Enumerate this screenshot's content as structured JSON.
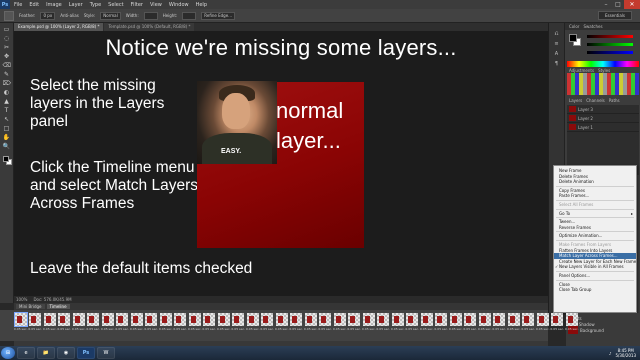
{
  "menubar": {
    "logo": "Ps",
    "items": [
      "File",
      "Edit",
      "Image",
      "Layer",
      "Type",
      "Select",
      "Filter",
      "View",
      "Window",
      "Help"
    ],
    "win_buttons": [
      "–",
      "□",
      "✕"
    ]
  },
  "options": {
    "feather_label": "Feather:",
    "feather_value": "0 px",
    "antialias_label": "Anti-alias",
    "style_label": "Style:",
    "style_value": "Normal",
    "width_label": "Width:",
    "height_label": "Height:",
    "refine_label": "Refine Edge...",
    "workspace": "Essentials"
  },
  "doc_tabs": [
    {
      "label": "Example.psd @ 100% (Layer 2, RGB/8) *"
    },
    {
      "label": "Template.psd @ 100% (Default, RGB/8) *"
    }
  ],
  "tools": [
    "▭",
    "◌",
    "✂",
    "✥",
    "⌫",
    "✎",
    "⌦",
    "◐",
    "▲",
    "T",
    "↖",
    "□",
    "✋",
    "🔍"
  ],
  "slide": {
    "title": "Notice we're missing some layers...",
    "instruction_1": "Select the missing layers in the Layers panel",
    "instruction_2": "Click the Timeline menu and select Match Layers Across Frames",
    "instruction_3": "Leave the default items checked",
    "red_box_text": "normal layer...",
    "photo_caption": "EASY."
  },
  "panels": {
    "color_tabs": [
      "Color",
      "Swatches"
    ],
    "adjust_tabs": [
      "Adjustments",
      "Styles"
    ],
    "layer_tabs": [
      "Layers",
      "Channels",
      "Paths"
    ],
    "layer_rows": [
      "Layer 3",
      "Layer 2",
      "Layer 1"
    ],
    "fx_rows": [
      "Effects",
      "Drop Shadow",
      "Background"
    ]
  },
  "context_menu": {
    "items": [
      {
        "label": "New Frame",
        "state": "normal"
      },
      {
        "label": "Delete Frames",
        "state": "normal"
      },
      {
        "label": "Delete Animation",
        "state": "normal"
      },
      {
        "sep": true
      },
      {
        "label": "Copy Frames",
        "state": "normal"
      },
      {
        "label": "Paste Frames...",
        "state": "normal"
      },
      {
        "sep": true
      },
      {
        "label": "Select All Frames",
        "state": "disabled"
      },
      {
        "sep": true
      },
      {
        "label": "Go To",
        "state": "normal",
        "arrow": "▸"
      },
      {
        "sep": true
      },
      {
        "label": "Tween...",
        "state": "normal"
      },
      {
        "label": "Reverse Frames",
        "state": "normal"
      },
      {
        "sep": true
      },
      {
        "label": "Optimize Animation...",
        "state": "normal"
      },
      {
        "sep": true
      },
      {
        "label": "Make Frames From Layers",
        "state": "disabled"
      },
      {
        "label": "Flatten Frames Into Layers",
        "state": "normal"
      },
      {
        "label": "Match Layer Across Frames...",
        "state": "highlighted"
      },
      {
        "label": "Create New Layer for Each New Frame",
        "state": "normal"
      },
      {
        "label": "New Layers Visible in All Frames",
        "state": "checked"
      },
      {
        "sep": true
      },
      {
        "label": "Panel Options...",
        "state": "normal"
      },
      {
        "sep": true
      },
      {
        "label": "Close",
        "state": "normal"
      },
      {
        "label": "Close Tab Group",
        "state": "normal"
      }
    ]
  },
  "status": {
    "zoom": "100%",
    "doc_info": "Doc: 576.0K/45.9M"
  },
  "timeline": {
    "tabs": [
      "Mini Bridge",
      "Timeline"
    ],
    "frame_count": 39,
    "frame_duration": "0.05 sec."
  },
  "taskbar": {
    "start": "⊞",
    "apps": [
      "e",
      "📁",
      "◉",
      "Ps",
      "W"
    ],
    "time": "8:45 PM",
    "date": "5/30/2013"
  }
}
